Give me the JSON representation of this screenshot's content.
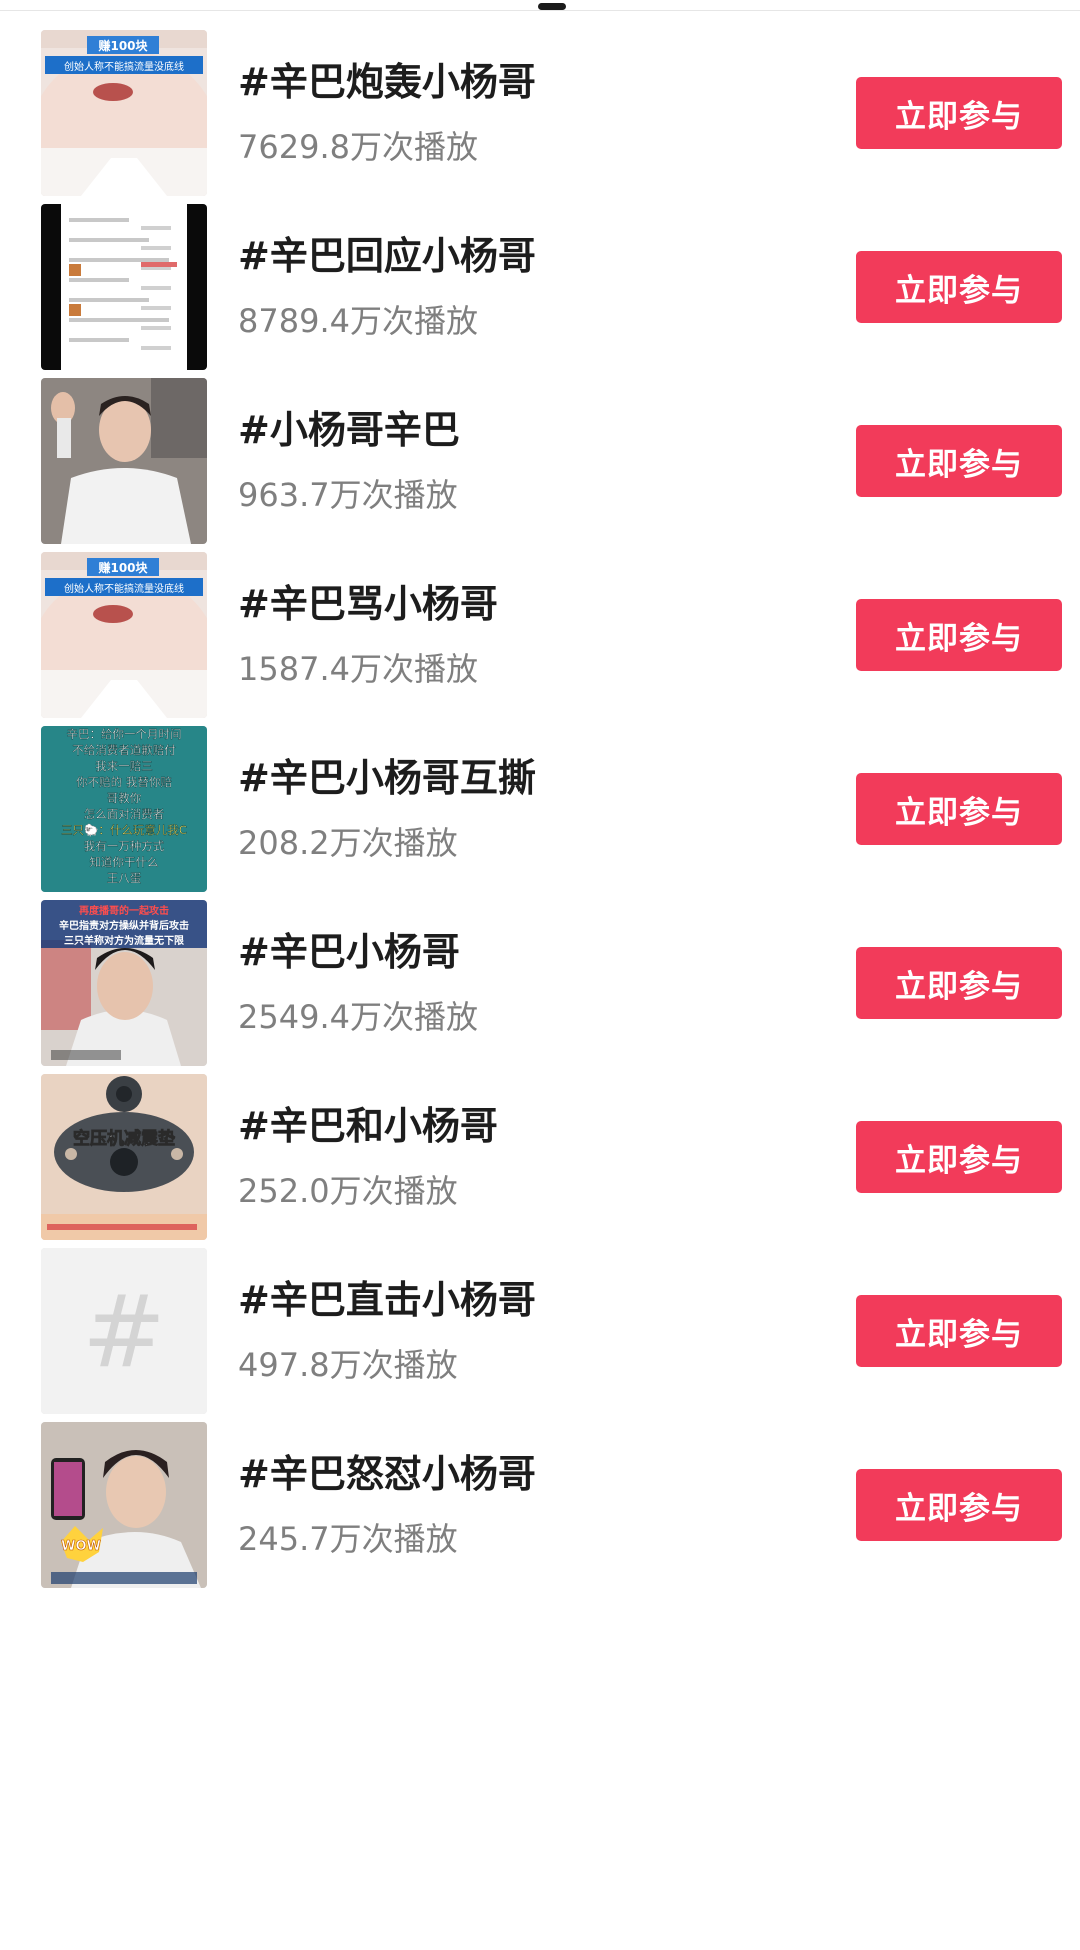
{
  "topics": [
    {
      "title": "#辛巴炮轰小杨哥",
      "plays": "7629.8万次播放",
      "button": "立即参与",
      "thumb": "face-banner",
      "banner_top": "赚100块",
      "banner_bottom": "创始人称不能搞流量没底线"
    },
    {
      "title": "#辛巴回应小杨哥",
      "plays": "8789.4万次播放",
      "button": "立即参与",
      "thumb": "order-screenshot"
    },
    {
      "title": "#小杨哥辛巴",
      "plays": "963.7万次播放",
      "button": "立即参与",
      "thumb": "man-white-shirt"
    },
    {
      "title": "#辛巴骂小杨哥",
      "plays": "1587.4万次播放",
      "button": "立即参与",
      "thumb": "face-banner",
      "banner_top": "赚100块",
      "banner_bottom": "创始人称不能搞流量没底线"
    },
    {
      "title": "#辛巴小杨哥互撕",
      "plays": "208.2万次播放",
      "button": "立即参与",
      "thumb": "text-card",
      "lines": [
        "辛巴：给你一个月时间",
        "不给消费者道歉赔付",
        "我来一赔三",
        "你不赔的 我替你赔",
        "哥教你",
        "怎么面对消费者",
        "三只🐑：什么玩意儿我C",
        "我有一万种方式",
        "知道你干什么",
        "王八蛋"
      ]
    },
    {
      "title": "#辛巴小杨哥",
      "plays": "2549.4万次播放",
      "button": "立即参与",
      "thumb": "man-caption",
      "lines": [
        "再度播哥的一起攻击",
        "辛巴指责对方操纵并背后攻击",
        "三只羊称对方为流量无下限"
      ]
    },
    {
      "title": "#辛巴和小杨哥",
      "plays": "252.0万次播放",
      "button": "立即参与",
      "thumb": "product",
      "label": "空压机减震垫"
    },
    {
      "title": "#辛巴直击小杨哥",
      "plays": "497.8万次播放",
      "button": "立即参与",
      "thumb": "hashtag-placeholder",
      "symbol": "#"
    },
    {
      "title": "#辛巴怒怼小杨哥",
      "plays": "245.7万次播放",
      "button": "立即参与",
      "thumb": "man-phone",
      "label": "WOW"
    }
  ],
  "colors": {
    "accent": "#f23b5a",
    "title": "#1d1d1d",
    "subtext": "#7f7f7f",
    "background": "#ffffff"
  }
}
